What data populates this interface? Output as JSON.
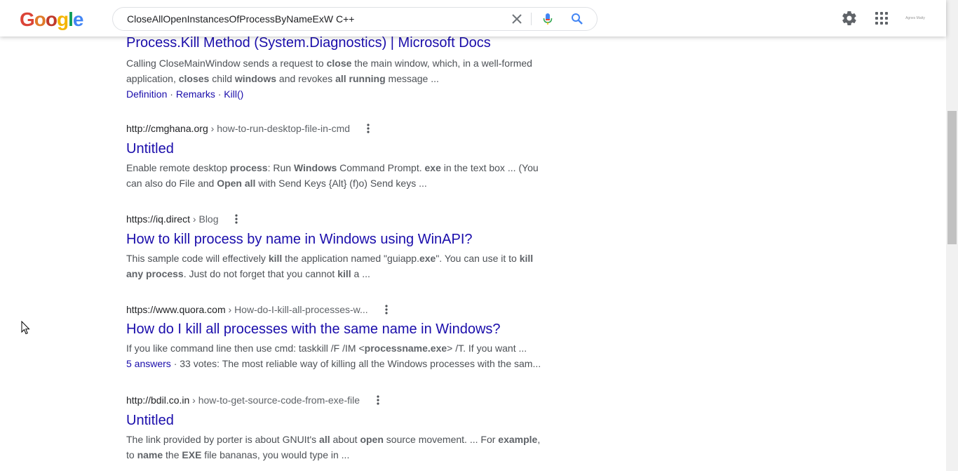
{
  "search": {
    "query": "CloseAllOpenInstancesOfProcessByNameExW C++"
  },
  "logo": {
    "letters": [
      "G",
      "o",
      "o",
      "g",
      "l",
      "e"
    ]
  },
  "avatar": {
    "text": "Agnes Matty"
  },
  "results": [
    {
      "title": "Process.Kill Method (System.Diagnostics) | Microsoft Docs",
      "snippet_parts": [
        [
          "Calling CloseMainWindow sends a request to ",
          false
        ],
        [
          "close",
          true
        ],
        [
          " the main window, which, in a well-formed application, ",
          false
        ],
        [
          "closes",
          true
        ],
        [
          " child ",
          false
        ],
        [
          "windows",
          true
        ],
        [
          " and revokes ",
          false
        ],
        [
          "all running",
          true
        ],
        [
          " message ...",
          false
        ]
      ],
      "links": [
        "Definition",
        "Remarks",
        "Kill()"
      ]
    },
    {
      "site": "http://cmghana.org",
      "path": " › how-to-run-desktop-file-in-cmd",
      "title": "Untitled",
      "snippet_parts": [
        [
          "Enable remote desktop ",
          false
        ],
        [
          "process",
          true
        ],
        [
          ": Run ",
          false
        ],
        [
          "Windows",
          true
        ],
        [
          " Command Prompt. ",
          false
        ],
        [
          "exe",
          true
        ],
        [
          " in the text box ... (You can also do File and ",
          false
        ],
        [
          "Open all",
          true
        ],
        [
          " with Send Keys {Alt} (f)o) Send keys ...",
          false
        ]
      ]
    },
    {
      "site": "https://iq.direct",
      "path": " › Blog",
      "title": "How to kill process by name in Windows using WinAPI?",
      "snippet_parts": [
        [
          "This sample code will effectively ",
          false
        ],
        [
          "kill",
          true
        ],
        [
          " the application named \"guiapp.",
          false
        ],
        [
          "exe",
          true
        ],
        [
          "\". You can use it to ",
          false
        ],
        [
          "kill any process",
          true
        ],
        [
          ". Just do not forget that you cannot ",
          false
        ],
        [
          "kill",
          true
        ],
        [
          " a ...",
          false
        ]
      ]
    },
    {
      "site": "https://www.quora.com",
      "path": " › How-do-I-kill-all-processes-w...",
      "title": "How do I kill all processes with the same name in Windows?",
      "snippet_parts": [
        [
          "If you like command line then use cmd: taskkill /F /IM <",
          false
        ],
        [
          "processname.exe",
          true
        ],
        [
          "> /T. If you want ...",
          false
        ]
      ],
      "answers_link": "5 answers",
      "answers_rest": " · 33 votes: The most reliable way of killing all the Windows processes with the sam..."
    },
    {
      "site": "http://bdil.co.in",
      "path": " › how-to-get-source-code-from-exe-file",
      "title": "Untitled",
      "snippet_parts": [
        [
          "The link provided by porter is about GNUIt's ",
          false
        ],
        [
          "all",
          true
        ],
        [
          " about ",
          false
        ],
        [
          "open",
          true
        ],
        [
          " source movement. ... For ",
          false
        ],
        [
          "example",
          true
        ],
        [
          ", to ",
          false
        ],
        [
          "name",
          true
        ],
        [
          " the ",
          false
        ],
        [
          "EXE",
          true
        ],
        [
          " file bananas, you would type in ...",
          false
        ]
      ]
    }
  ],
  "colors": {
    "link": "#1a0dab",
    "text": "#4d5156",
    "cite": "#202124",
    "accent_blue": "#4285f4"
  },
  "icons": [
    "clear-icon",
    "mic-icon",
    "search-icon",
    "gear-icon",
    "apps-grid-icon",
    "more-vert-icon",
    "mouse-cursor-icon"
  ]
}
